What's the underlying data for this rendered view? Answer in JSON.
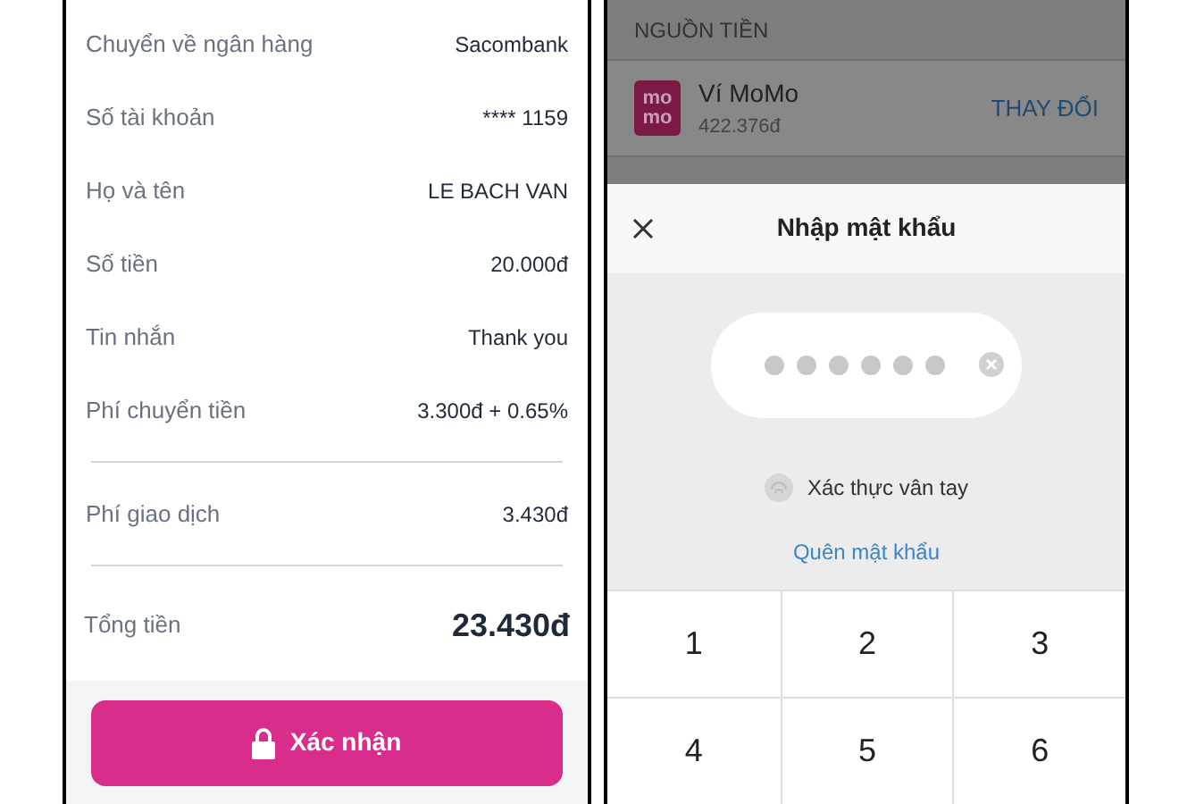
{
  "confirm_screen": {
    "rows": [
      {
        "label": "Chuyển về ngân hàng",
        "value": "Sacombank",
        "divider_after": false
      },
      {
        "label": "Số tài khoản",
        "value": "**** 1159",
        "divider_after": false
      },
      {
        "label": "Họ và tên",
        "value": "LE BACH VAN",
        "divider_after": false
      },
      {
        "label": "Số tiền",
        "value": "20.000đ",
        "divider_after": false
      },
      {
        "label": "Tin nhắn",
        "value": "Thank you",
        "divider_after": false
      },
      {
        "label": "Phí chuyển tiền",
        "value": "3.300đ + 0.65%",
        "divider_after": true
      },
      {
        "label": "Phí giao dịch",
        "value": "3.430đ",
        "divider_after": true
      }
    ],
    "total": {
      "label": "Tổng tiền",
      "value": "23.430đ"
    },
    "confirm_button": "Xác nhận"
  },
  "password_screen": {
    "source_header": "NGUỒN TIỀN",
    "wallet": {
      "logo": [
        "mo",
        "mo"
      ],
      "name": "Ví MoMo",
      "balance": "422.376đ",
      "change_link": "THAY ĐỔI"
    },
    "sheet": {
      "title": "Nhập mật khẩu",
      "pin_dots": [
        {
          "filled": true
        },
        {
          "filled": true
        },
        {
          "filled": true
        },
        {
          "filled": true
        },
        {
          "filled": true
        },
        {
          "filled": true
        }
      ],
      "fingerprint": "Xác thực vân tay",
      "forgot_link": "Quên mật khẩu",
      "keys": [
        "1",
        "2",
        "3",
        "4",
        "5",
        "6"
      ]
    }
  }
}
